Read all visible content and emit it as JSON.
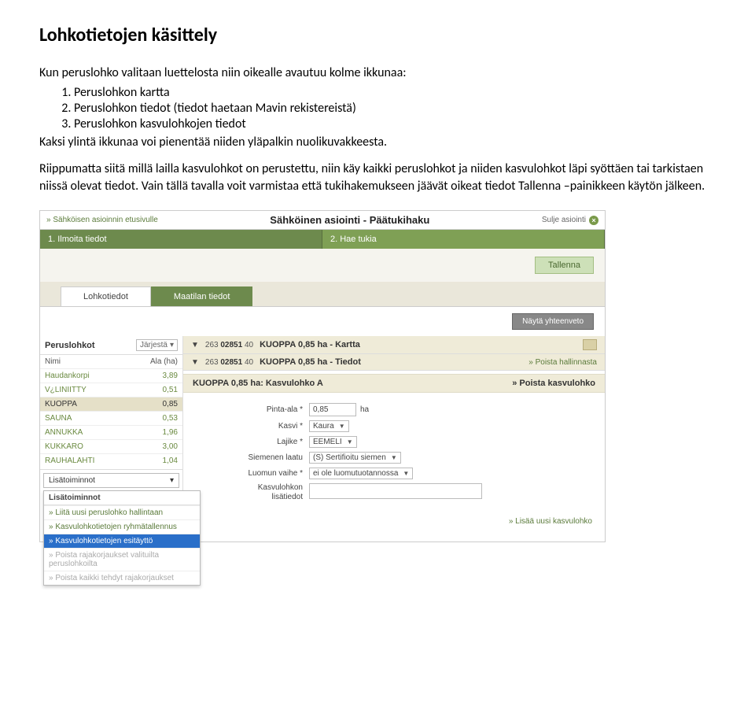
{
  "doc": {
    "title": "Lohkotietojen käsittely",
    "intro1": "Kun peruslohko valitaan luettelosta niin oikealle avautuu kolme ikkunaa:",
    "list": [
      "Peruslohkon kartta",
      "Peruslohkon tiedot (tiedot haetaan Mavin rekistereistä)",
      "Peruslohkon kasvulohkojen tiedot"
    ],
    "intro2": "Kaksi ylintä ikkunaa voi pienentää niiden yläpalkin nuolikuvakkeesta.",
    "para": "Riippumatta siitä millä lailla kasvulohkot on perustettu, niin käy kaikki peruslohkot ja niiden kasvulohkot läpi syöttäen tai tarkistaen niissä olevat tiedot. Vain tällä tavalla voit varmistaa että tukihakemukseen jäävät oikeat tiedot Tallenna –painikkeen käytön jälkeen."
  },
  "ss": {
    "back": "» Sähköisen asioinnin etusivulle",
    "title": "Sähköinen asiointi  -  Päätukihaku",
    "close": "Sulje asiointi",
    "tabs": [
      "1. Ilmoita tiedot",
      "2. Hae tukia"
    ],
    "save": "Tallenna",
    "subtabs": [
      "Lohkotiedot",
      "Maatilan tiedot"
    ],
    "summary": "Näytä yhteenveto",
    "sidebar": {
      "head": "Peruslohkot",
      "sort": "Järjestä",
      "colName": "Nimi",
      "colArea": "Ala (ha)",
      "rows": [
        {
          "name": "Haudankorpi",
          "area": "3,89"
        },
        {
          "name": "V¿LINIITTY",
          "area": "0,51"
        },
        {
          "name": "KUOPPA",
          "area": "0,85",
          "selected": true
        },
        {
          "name": "SAUNA",
          "area": "0,53"
        },
        {
          "name": "ANNUKKA",
          "area": "1,96"
        },
        {
          "name": "KUKKARO",
          "area": "3,00"
        },
        {
          "name": "RAUHALAHTI",
          "area": "1,04"
        }
      ],
      "actions": "Lisätoiminnot",
      "dropdown": {
        "head": "Lisätoiminnot",
        "items": [
          {
            "t": "» Liitä uusi peruslohko hallintaan"
          },
          {
            "t": "» Kasvulohkotietojen ryhmätallennus"
          },
          {
            "t": "» Kasvulohkotietojen esitäyttö",
            "hi": true
          },
          {
            "t": "» Poista rajakorjaukset valituilta peruslohkoilta",
            "muted": true
          },
          {
            "t": "» Poista kaikki tehdyt rajakorjaukset",
            "muted": true
          }
        ]
      }
    },
    "bars": [
      {
        "id1": "263",
        "id2": "02851",
        "id3": "40",
        "label": "KUOPPA 0,85 ha - Kartta",
        "corner": true
      },
      {
        "id1": "263",
        "id2": "02851",
        "id3": "40",
        "label": "KUOPPA 0,85 ha - Tiedot",
        "link": "» Poista hallinnasta"
      }
    ],
    "subhead": {
      "title": "KUOPPA 0,85 ha: Kasvulohko A",
      "link": "» Poista kasvulohko"
    },
    "form": {
      "r1": {
        "label": "Pinta-ala *",
        "value": "0,85",
        "unit": "ha"
      },
      "r2": {
        "label": "Kasvi *",
        "value": "Kaura"
      },
      "r3": {
        "label": "Lajike *",
        "value": "EEMELI"
      },
      "r4": {
        "label": "Siemenen laatu",
        "value": "(S) Sertifioitu siemen"
      },
      "r5": {
        "label": "Luomun vaihe *",
        "value": "ei ole luomutuotannossa"
      },
      "r6a": "Kasvulohkon",
      "r6b": "lisätiedot"
    },
    "addlink": "» Lisää uusi kasvulohko"
  }
}
